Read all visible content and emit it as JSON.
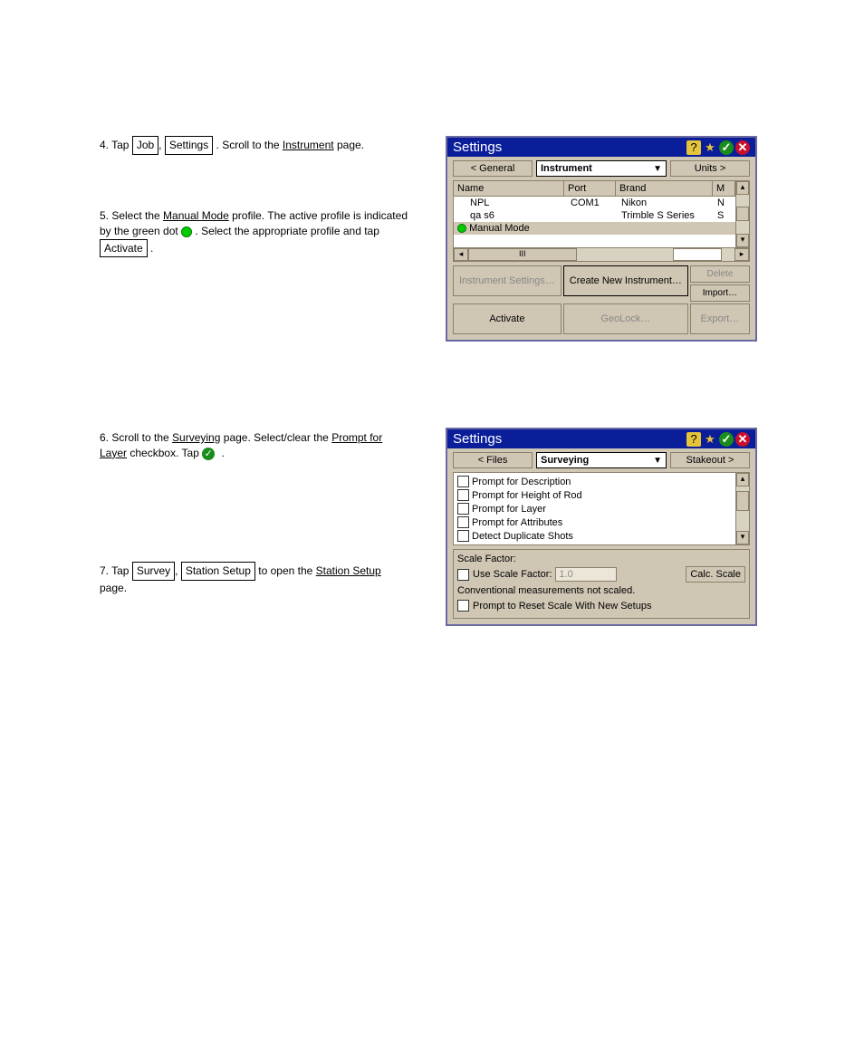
{
  "instructions": {
    "step4": {
      "prefix": "4. Tap ",
      "job_btn": "Job",
      "settings_btn": "Settings",
      "mid": ". Scroll to the ",
      "instrument_u": "Instrument",
      "page_label": " page."
    },
    "step5": {
      "prefix": "5. Select the ",
      "manual_mode": "Manual Mode",
      "mid": " profile. The active profile is indicated by the green dot ",
      "after_dot": ". Select the appropriate profile and tap ",
      "activate_btn": "Activate",
      "end": "."
    },
    "step6": {
      "prefix": "6. Scroll to the ",
      "surveying_u": "Surveying",
      "page_mid": " page. Select/clear the ",
      "prompt_layer": "Prompt for Layer",
      "mid2": " checkbox. Tap ",
      "end": "."
    },
    "step7": {
      "prefix": "7. Tap ",
      "survey_btn": "Survey",
      "station_btn": "Station Setup",
      "mid": " to open the ",
      "station_u": "Station Setup",
      "page_label": " page."
    }
  },
  "panel1": {
    "title": "Settings",
    "nav": {
      "prev": "< General",
      "current": "Instrument",
      "next": "Units >"
    },
    "columns": {
      "name": "Name",
      "port": "Port",
      "brand": "Brand",
      "m": "M"
    },
    "rows": [
      {
        "name": "NPL",
        "port": "COM1",
        "brand": "Nikon",
        "m": "N"
      },
      {
        "name": "qa s6",
        "port": "",
        "brand": "Trimble S Series",
        "m": "S"
      },
      {
        "name": "Manual Mode",
        "port": "",
        "brand": "",
        "m": "",
        "active": true
      }
    ],
    "buttons": {
      "instr_settings": "Instrument Settings…",
      "create_new": "Create New Instrument…",
      "delete": "Delete",
      "import": "Import…",
      "activate": "Activate",
      "geolock": "GeoLock…",
      "export": "Export…"
    }
  },
  "panel2": {
    "title": "Settings",
    "nav": {
      "prev": "< Files",
      "current": "Surveying",
      "next": "Stakeout >"
    },
    "checks": [
      "Prompt for Description",
      "Prompt for Height of Rod",
      "Prompt for Layer",
      "Prompt for Attributes",
      "Detect Duplicate Shots"
    ],
    "scale": {
      "legend": "Scale Factor:",
      "use_label": "Use Scale Factor:",
      "value": "1.0",
      "calc_btn": "Calc. Scale",
      "note": "Conventional measurements not scaled.",
      "prompt_reset": "Prompt to Reset Scale With New Setups"
    }
  }
}
